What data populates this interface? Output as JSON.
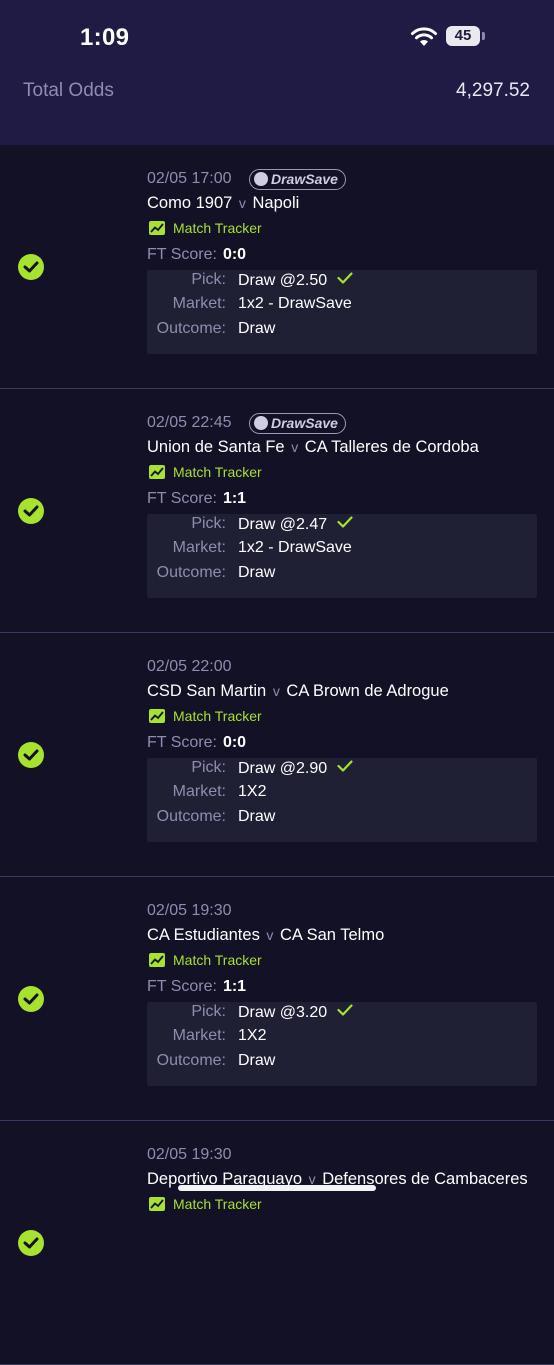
{
  "status_bar": {
    "time": "1:09",
    "battery": "45"
  },
  "summary": {
    "total_odds_label": "Total Odds",
    "total_odds_value": "4,297.52"
  },
  "labels": {
    "badge": "DrawSave",
    "match_tracker": "Match Tracker",
    "ft_score": "FT Score:",
    "pick": "Pick:",
    "market": "Market:",
    "outcome": "Outcome:",
    "vs": "v"
  },
  "bets": [
    {
      "datetime": "02/05 17:00",
      "drawsave": true,
      "home": "Como 1907",
      "away": "Napoli",
      "ft_score": "0:0",
      "pick": "Draw @2.50",
      "market": "1x2 - DrawSave",
      "outcome": "Draw",
      "status": "won"
    },
    {
      "datetime": "02/05 22:45",
      "drawsave": true,
      "home": "Union de Santa Fe",
      "away": "CA Talleres de Cordoba",
      "ft_score": "1:1",
      "pick": "Draw @2.47",
      "market": "1x2 - DrawSave",
      "outcome": "Draw",
      "status": "won"
    },
    {
      "datetime": "02/05 22:00",
      "drawsave": false,
      "home": "CSD San Martin",
      "away": "CA Brown de Adrogue",
      "ft_score": "0:0",
      "pick": "Draw @2.90",
      "market": "1X2",
      "outcome": "Draw",
      "status": "won"
    },
    {
      "datetime": "02/05 19:30",
      "drawsave": false,
      "home": "CA Estudiantes",
      "away": "CA San Telmo",
      "ft_score": "1:1",
      "pick": "Draw @3.20",
      "market": "1X2",
      "outcome": "Draw",
      "status": "won"
    },
    {
      "datetime": "02/05 19:30",
      "drawsave": false,
      "home": "Deportivo Paraguayo",
      "away": "Defensores de Cambaceres",
      "ft_score": "",
      "pick": "",
      "market": "",
      "outcome": "",
      "status": "won"
    }
  ],
  "colors": {
    "accent": "#a6e22e",
    "header_bg": "#1f1b45",
    "page_bg": "#131125",
    "detail_bg": "#202035"
  },
  "icons": {
    "won": "check-circle-icon",
    "tracker": "trend-chart-icon",
    "pick_ok": "checkmark-icon"
  }
}
